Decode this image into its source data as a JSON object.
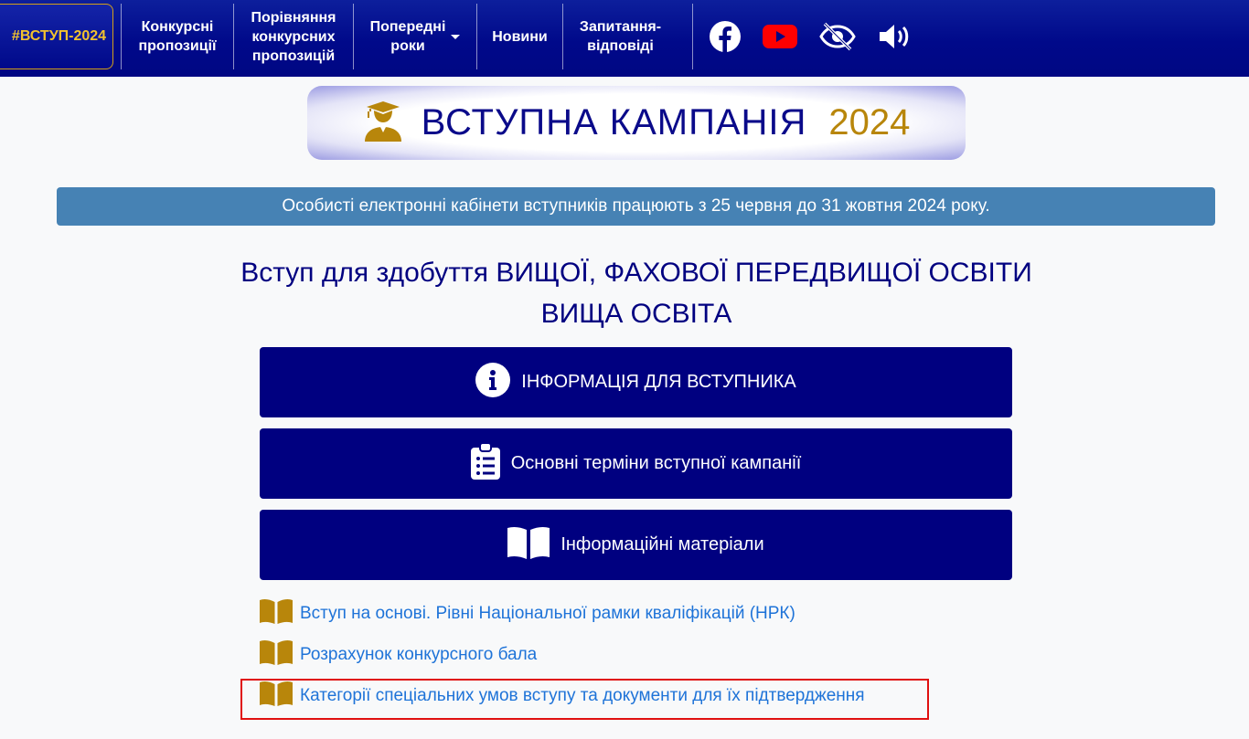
{
  "navbar": {
    "brand": "#ВСТУП-2024",
    "items": [
      {
        "label": "Конкурсні\nпропозиції"
      },
      {
        "label": "Порівняння\nконкурсних\nпропозицій"
      },
      {
        "label": "Попередні\nроки"
      },
      {
        "label": "Новини"
      },
      {
        "label": "Запитання-\nвідповіді"
      }
    ],
    "icons": [
      "facebook-icon",
      "youtube-icon",
      "low-vision-icon",
      "sound-icon"
    ]
  },
  "banner": {
    "title": "ВСТУПНА КАМПАНІЯ",
    "year": "2024"
  },
  "alert": {
    "text": "Особисті електронні кабінети вступників працюють з 25 червня до 31 жовтня 2024 року."
  },
  "headings": {
    "line1": "Вступ для здобуття ВИЩОЇ, ФАХОВОЇ ПЕРЕДВИЩОЇ ОСВІТИ",
    "line2": "ВИЩА ОСВІТА"
  },
  "buttons": [
    {
      "label": "ІНФОРМАЦІЯ ДЛЯ ВСТУПНИКА",
      "icon": "info-icon"
    },
    {
      "label": "Основні терміни вступної кампанії",
      "icon": "clipboard-list-icon"
    },
    {
      "label": "Інформаційні матеріали",
      "icon": "book-icon"
    }
  ],
  "links": [
    {
      "label": "Вступ на основі. Рівні Національної рамки кваліфікацій (НРК)"
    },
    {
      "label": "Розрахунок конкурсного бала"
    },
    {
      "label": "Категорії спеціальних умов вступу та документи для їх підтвердження"
    }
  ],
  "colors": {
    "navy": "#000080",
    "gold": "#b8860b",
    "alert": "#4682b4",
    "link": "#1e73d8"
  }
}
